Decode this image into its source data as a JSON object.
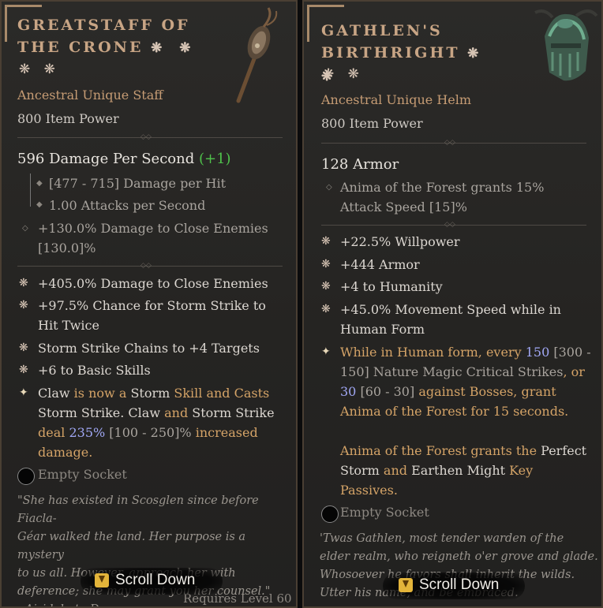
{
  "left": {
    "title": "Greatstaff of the Crone",
    "title_stars": "❋ ❋",
    "extra_stars": "❋ ❋",
    "subtype": "Ancestral Unique Staff",
    "item_power": "800 Item Power",
    "main_stat": "596 Damage Per Second",
    "main_stat_delta": "(+1)",
    "sub_stats": [
      "[477 - 715] Damage per Hit",
      "1.00 Attacks per Second"
    ],
    "implicit_line1": "+130.0% Damage to Close Enemies",
    "implicit_line2": "[130.0]%",
    "affixes": [
      "+405.0% Damage to Close Enemies",
      "+97.5% Chance for Storm Strike to",
      "Hit Twice",
      "Storm Strike Chains to +4 Targets",
      "+6 to Basic Skills"
    ],
    "unique_power": {
      "l1a": "Claw",
      "l1b": " is now a ",
      "l1c": "Storm",
      "l1d": " Skill and Casts",
      "l2a": "Storm Strike",
      "l2b": ". Claw",
      "l2c": " and ",
      "l2d": "Storm Strike",
      "l3a": "deal ",
      "l3b": "235%",
      "l3c": " [100 - 250]%",
      "l3d": " increased",
      "l4a": "damage."
    },
    "socket": "Empty Socket",
    "flavor": [
      "\"She has existed in Scosglen since before Fiacla-",
      "Géar walked the land. Her purpose is a mystery",
      "to us all. However, approach her with",
      "deference; she may grant you her counsel.\"",
      "- Airidah, to D"
    ],
    "scroll": "Scroll Down",
    "requires": "Requires Level 60"
  },
  "right": {
    "title_line1": "Gathlen's",
    "title_line2": "Birthright",
    "title_stars": "❋ ❋",
    "extra_stars": "❋ ❋",
    "subtype": "Ancestral Unique Helm",
    "item_power": "800 Item Power",
    "main_stat": "128 Armor",
    "implicit_line1": "Anima of the Forest grants 15%",
    "implicit_line2": "Attack Speed [15]%",
    "affixes": [
      "+22.5% Willpower",
      "+444 Armor",
      "+4 to Humanity",
      "+45.0% Movement Speed while in",
      "Human Form"
    ],
    "unique_power": {
      "l1a": "While in Human form, every ",
      "l1b": "150",
      "l1c": " [300 -",
      "l2a": "150] Nature Magic Critical Strikes",
      "l2b": ", or",
      "l3a": "30",
      "l3b": " [60 - 30]",
      "l3c": " against Bosses, grant",
      "l4a": "Anima of the Forest for 15 seconds.",
      "l5a": "Anima of the Forest grants the ",
      "l5b": "Perfect",
      "l6a": "Storm",
      "l6b": " and ",
      "l6c": "Earthen Might",
      "l6d": " Key",
      "l7a": "Passives."
    },
    "socket": "Empty Socket",
    "flavor": [
      "'Twas Gathlen, most tender warden of the",
      "elder realm, who reigneth o'er grove and glade.",
      "Whosoever he favors shall inherit the wilds.",
      "Utter his name, and be embraced."
    ],
    "scroll": "Scroll Down"
  },
  "colors": {
    "title": "#c8a585",
    "subtype": "#c69c74",
    "unique_orange": "#d4a367",
    "value_blue": "#a0a7f4",
    "upgrade_green": "#4fc24b",
    "border": "#4a3f33"
  },
  "icons": {
    "left_item": "staff-icon",
    "right_item": "helm-icon",
    "affix_bullet": "star-bullet-icon",
    "unique_bullet": "sparkle-icon",
    "socket": "socket-icon",
    "scroll_key": "key-icon"
  }
}
